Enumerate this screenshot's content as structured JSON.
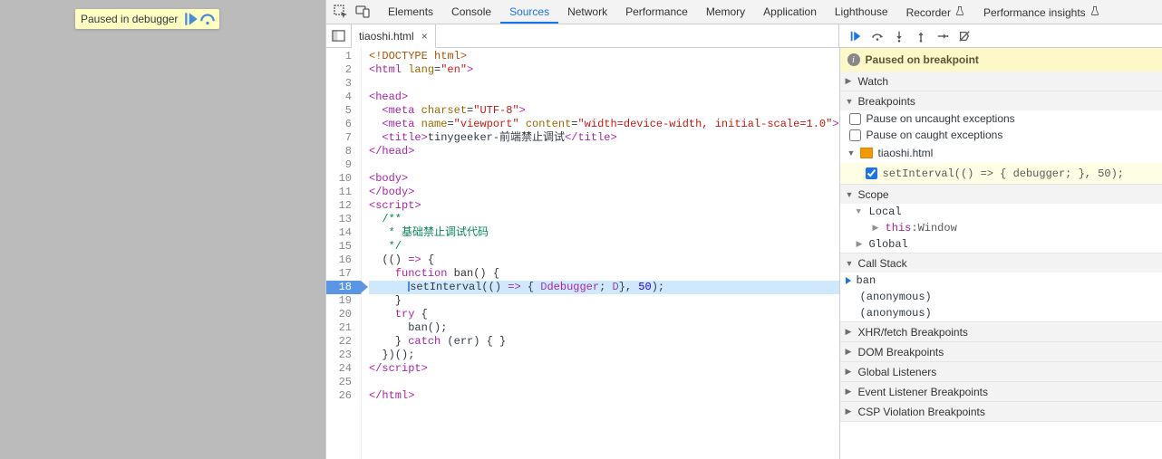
{
  "page_pill": {
    "label": "Paused in debugger"
  },
  "devtools_tabs": [
    "Elements",
    "Console",
    "Sources",
    "Network",
    "Performance",
    "Memory",
    "Application",
    "Lighthouse",
    "Recorder",
    "Performance insights"
  ],
  "devtools_selected": "Sources",
  "experiment_tabs": [
    "Recorder",
    "Performance insights"
  ],
  "open_file": {
    "name": "tiaoshi.html"
  },
  "code": {
    "lines": [
      {
        "n": 1,
        "html": "<span class='tok-doc'>&lt;!DOCTYPE html&gt;</span>"
      },
      {
        "n": 2,
        "html": "<span class='tok-tag'>&lt;html</span> <span class='tok-attr'>lang</span>=<span class='tok-str'>\"en\"</span><span class='tok-tag'>&gt;</span>"
      },
      {
        "n": 3,
        "html": ""
      },
      {
        "n": 4,
        "html": "<span class='tok-tag'>&lt;head&gt;</span>"
      },
      {
        "n": 5,
        "html": "  <span class='tok-tag'>&lt;meta</span> <span class='tok-attr'>charset</span>=<span class='tok-str'>\"UTF-8\"</span><span class='tok-tag'>&gt;</span>"
      },
      {
        "n": 6,
        "html": "  <span class='tok-tag'>&lt;meta</span> <span class='tok-attr'>name</span>=<span class='tok-str'>\"viewport\"</span> <span class='tok-attr'>content</span>=<span class='tok-str'>\"width=device-width, initial-scale=1.0\"</span><span class='tok-tag'>&gt;</span>"
      },
      {
        "n": 7,
        "html": "  <span class='tok-tag'>&lt;title&gt;</span>tinygeeker-前端禁止调试<span class='tok-tag'>&lt;/title&gt;</span>"
      },
      {
        "n": 8,
        "html": "<span class='tok-tag'>&lt;/head&gt;</span>"
      },
      {
        "n": 9,
        "html": ""
      },
      {
        "n": 10,
        "html": "<span class='tok-tag'>&lt;body&gt;</span>"
      },
      {
        "n": 11,
        "html": "<span class='tok-tag'>&lt;/body&gt;</span>"
      },
      {
        "n": 12,
        "html": "<span class='tok-tag'>&lt;script&gt;</span>"
      },
      {
        "n": 13,
        "html": "  <span class='tok-com'>/**</span>"
      },
      {
        "n": 14,
        "html": "  <span class='tok-com'> * 基础禁止调试代码</span>"
      },
      {
        "n": 15,
        "html": "  <span class='tok-com'> */</span>"
      },
      {
        "n": 16,
        "html": "  (() <span class='tok-kw'>=&gt;</span> {"
      },
      {
        "n": 17,
        "html": "    <span class='tok-kw'>function</span> <span class='tok-fn'>ban</span>() {"
      },
      {
        "n": 18,
        "exec": true,
        "html": "      <span class='inline-cursor'></span>setInterval(() <span class='tok-kw'>=&gt;</span> { <span style='color:#8d46b0'>D</span><span class='tok-kw'>debugger</span>; <span style='color:#8d46b0'>D</span>}, <span class='tok-num'>50</span>);"
      },
      {
        "n": 19,
        "html": "    }"
      },
      {
        "n": 20,
        "html": "    <span class='tok-kw'>try</span> {"
      },
      {
        "n": 21,
        "html": "      ban();"
      },
      {
        "n": 22,
        "html": "    } <span class='tok-kw'>catch</span> (err) { }"
      },
      {
        "n": 23,
        "html": "  })();"
      },
      {
        "n": 24,
        "html": "<span class='tok-tag'>&lt;/script&gt;</span>"
      },
      {
        "n": 25,
        "html": ""
      },
      {
        "n": 26,
        "html": "<span class='tok-tag'>&lt;/html&gt;</span>"
      }
    ]
  },
  "sidebar": {
    "paused_banner": "Paused on breakpoint",
    "sections": {
      "watch": "Watch",
      "breakpoints": "Breakpoints",
      "pause_uncaught": "Pause on uncaught exceptions",
      "pause_caught": "Pause on caught exceptions",
      "bp_file": "tiaoshi.html",
      "bp_code": "setInterval(() => { debugger; }, 50);",
      "scope": "Scope",
      "scope_local": "Local",
      "scope_this_label": "this",
      "scope_this_value": "Window",
      "scope_global": "Global",
      "callstack": "Call Stack",
      "cs_frames": [
        "ban",
        "(anonymous)",
        "(anonymous)"
      ],
      "sec_xhr": "XHR/fetch Breakpoints",
      "sec_dom": "DOM Breakpoints",
      "sec_gl": "Global Listeners",
      "sec_el": "Event Listener Breakpoints",
      "sec_csp": "CSP Violation Breakpoints"
    }
  }
}
